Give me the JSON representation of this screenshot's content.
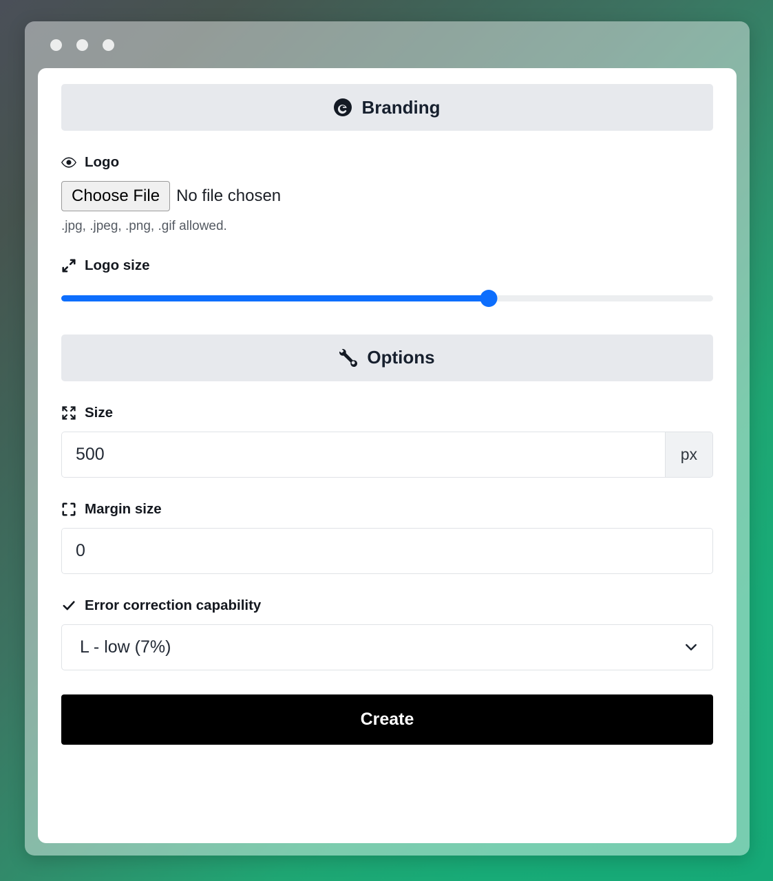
{
  "window": {
    "traffic_lights": [
      "close",
      "minimize",
      "maximize"
    ]
  },
  "branding": {
    "header_label": "Branding",
    "header_icon": "copyright-badge-icon",
    "logo": {
      "label": "Logo",
      "icon": "eye-icon",
      "choose_file_label": "Choose File",
      "file_status": "No file chosen",
      "help_text": ".jpg, .jpeg, .png, .gif allowed."
    },
    "logo_size": {
      "label": "Logo size",
      "icon": "arrows-angle-expand-icon",
      "value_percent": 65.6,
      "min": 0,
      "max": 100
    }
  },
  "options": {
    "header_label": "Options",
    "header_icon": "wrench-icon",
    "size": {
      "label": "Size",
      "icon": "arrows-fullscreen-icon",
      "value": "500",
      "placeholder": "500",
      "unit": "px"
    },
    "margin_size": {
      "label": "Margin size",
      "icon": "fullscreen-corners-icon",
      "value": "0",
      "placeholder": "0"
    },
    "error_correction": {
      "label": "Error correction capability",
      "icon": "check-icon",
      "selected": "L - low (7%)",
      "caret_icon": "chevron-down-icon"
    }
  },
  "actions": {
    "create_label": "Create"
  },
  "colors": {
    "accent_blue": "#0d6efd",
    "section_header_bg": "#e7e9ed",
    "primary_button_bg": "#000000",
    "gradient_start": "#4a4f58",
    "gradient_end": "#16a977"
  }
}
